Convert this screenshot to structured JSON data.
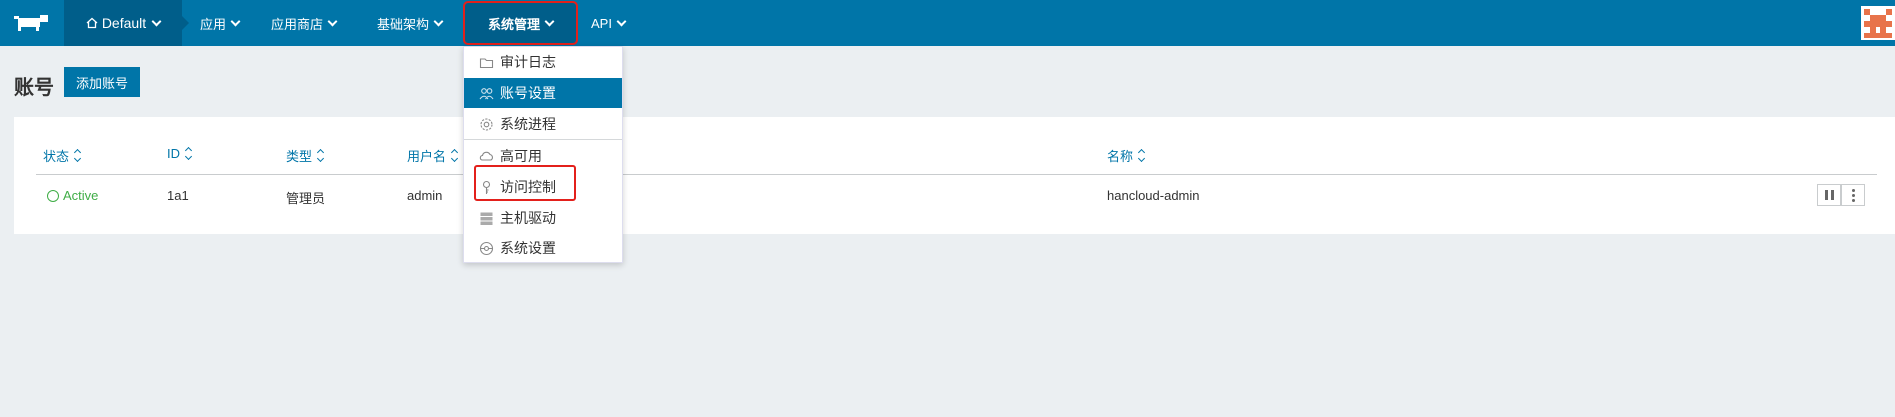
{
  "nav": {
    "env_label": "Default",
    "items": [
      "应用",
      "应用商店",
      "基础架构",
      "系统管理",
      "API"
    ]
  },
  "page": {
    "title": "账号",
    "add_button": "添加账号"
  },
  "table": {
    "headers": [
      "状态",
      "ID",
      "类型",
      "用户名",
      "名称"
    ],
    "rows": [
      {
        "state": "Active",
        "id": "1a1",
        "type": "管理员",
        "username": "admin",
        "name": "hancloud-admin"
      }
    ]
  },
  "dropdown": {
    "items": [
      "审计日志",
      "账号设置",
      "系统进程",
      "高可用",
      "访问控制",
      "主机驱动",
      "系统设置"
    ],
    "selected_index": 1,
    "highlighted_index": 4
  },
  "colors": {
    "nav_bg": "#0075a8",
    "nav_active_bg": "#005e8a",
    "accent": "#0075a8",
    "active_state": "#3fad46",
    "highlight_box": "#e3201b",
    "page_bg": "#ebeff2"
  },
  "icons": {
    "logo": "rancher-cow-logo",
    "env": "home-icon",
    "avatar": "user-avatar"
  }
}
